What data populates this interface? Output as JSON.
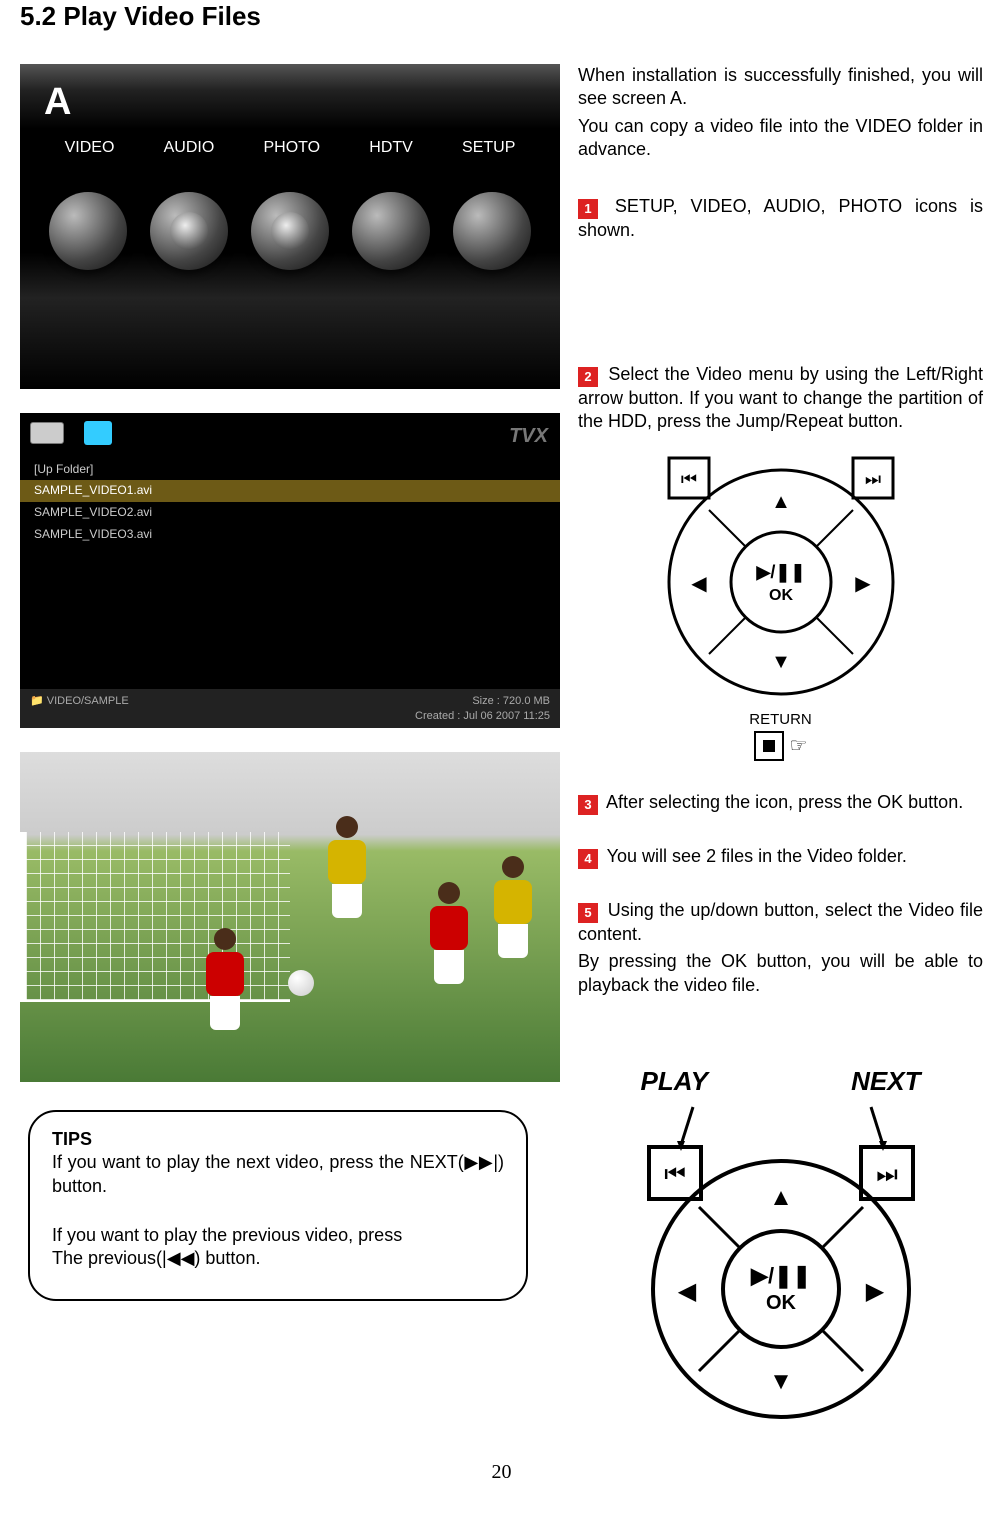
{
  "heading": "5.2    Play Video Files",
  "screenA": {
    "label": "A",
    "menu": [
      "VIDEO",
      "AUDIO",
      "PHOTO",
      "HDTV",
      "SETUP"
    ]
  },
  "fileBrowser": {
    "logo": "TVX",
    "upFolder": "[Up Folder]",
    "files": [
      "SAMPLE_VIDEO1.avi",
      "SAMPLE_VIDEO2.avi",
      "SAMPLE_VIDEO3.avi"
    ],
    "path": "VIDEO/SAMPLE",
    "sizeLine": "Size : 720.0 MB",
    "createdLine": "Created  : Jul 06  2007    11:25"
  },
  "intro1": "When installation is successfully finished, you will see screen A.",
  "intro2": "You can copy a video file into the VIDEO folder in advance.",
  "step1": " SETUP, VIDEO, AUDIO, PHOTO icons is shown.",
  "step2": " Select the Video menu by using the Left/Right arrow button. If you want to change the partition of the HDD, press the Jump/Repeat button.",
  "step3": " After selecting the icon, press the OK button.",
  "step4": " You will see 2 files in the Video folder.",
  "step5a": " Using the up/down button, select the Video file content.",
  "step5b": "By pressing the OK button, you will be able to playback the video file.",
  "returnLabel": "RETURN",
  "okLabel": "OK",
  "playPause": "▶/❚❚",
  "playLabel": "PLAY",
  "nextLabel": "NEXT",
  "tips": {
    "title": "TIPS",
    "line1": "If you want to play the next video, press the NEXT(▶▶|) button.",
    "line2": "If you want to play the previous video, press",
    "line3": "The previous(|◀◀) button."
  },
  "callouts": {
    "c1": "1",
    "c2": "2",
    "c3": "3",
    "c4": "4",
    "c5": "5"
  },
  "pageNumber": "20"
}
